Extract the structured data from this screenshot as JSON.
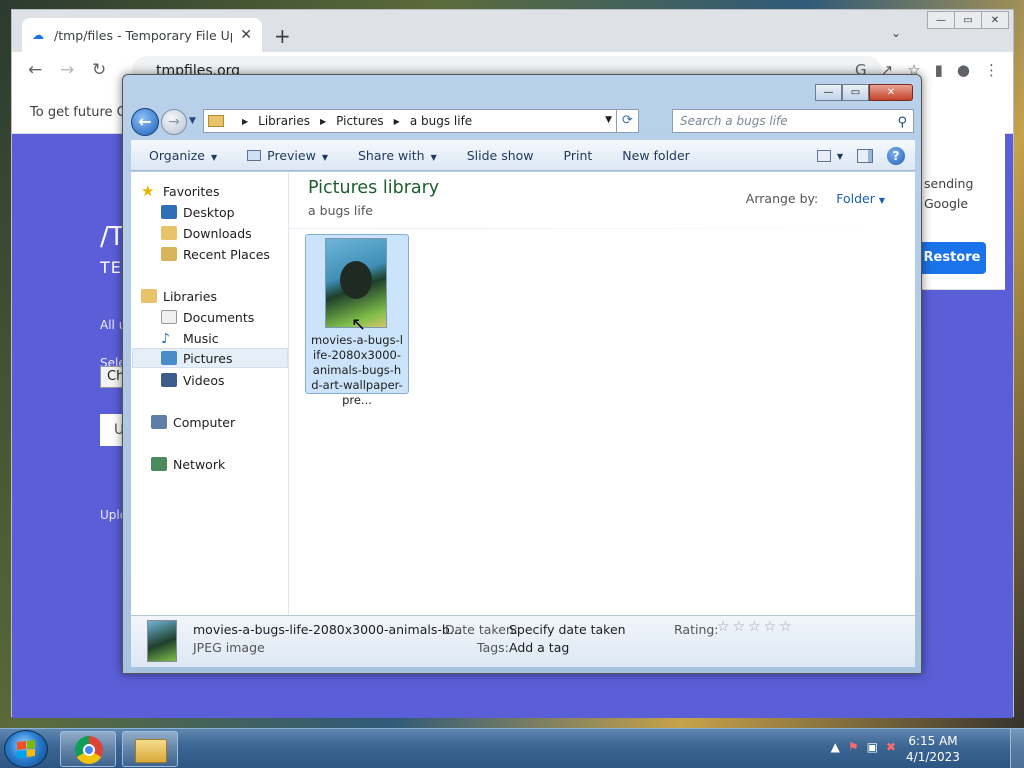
{
  "chrome": {
    "tab_title": "/tmp/files - Temporary File Uplo",
    "tab_close": "✕",
    "new_tab": "+",
    "tabs_dropdown": "⌄",
    "url": "tmpfiles.org",
    "infobar_text": "To get future Go",
    "infobar_close": "✕",
    "page": {
      "hero": "/T",
      "subtitle": "TE",
      "line1": "All u",
      "line2": "Sele",
      "choose_btn": "Ch",
      "upload_box": "U",
      "line3": "Uplo"
    },
    "restore_panel": {
      "text1": "sending",
      "text2": "Google",
      "restore_button": "Restore"
    }
  },
  "explorer": {
    "caption_buttons": {
      "minimize": "—",
      "maximize": "▭",
      "close": "✕"
    },
    "breadcrumb": [
      "Libraries",
      "Pictures",
      "a bugs life"
    ],
    "search_placeholder": "Search a bugs life",
    "commands": {
      "organize": "Organize",
      "preview": "Preview",
      "share_with": "Share with",
      "slide_show": "Slide show",
      "print": "Print",
      "new_folder": "New folder"
    },
    "nav": {
      "favorites": "Favorites",
      "desktop": "Desktop",
      "downloads": "Downloads",
      "recent_places": "Recent Places",
      "libraries": "Libraries",
      "documents": "Documents",
      "music": "Music",
      "pictures": "Pictures",
      "videos": "Videos",
      "computer": "Computer",
      "network": "Network"
    },
    "library_title": "Pictures library",
    "library_subtitle": "a bugs life",
    "arrange_label": "Arrange by:",
    "arrange_value": "Folder",
    "file": {
      "name": "movies-a-bugs-life-2080x3000-animals-bugs-hd-art-wallpaper-pre..."
    },
    "details": {
      "filename": "movies-a-bugs-life-2080x3000-animals-b...",
      "type": "JPEG image",
      "date_taken_label": "Date taken:",
      "date_taken_value": "Specify date taken",
      "tags_label": "Tags:",
      "tags_value": "Add a tag",
      "rating_label": "Rating:",
      "rating_stars": "☆☆☆☆☆"
    }
  },
  "taskbar": {
    "time": "6:15 AM",
    "date": "4/1/2023"
  }
}
